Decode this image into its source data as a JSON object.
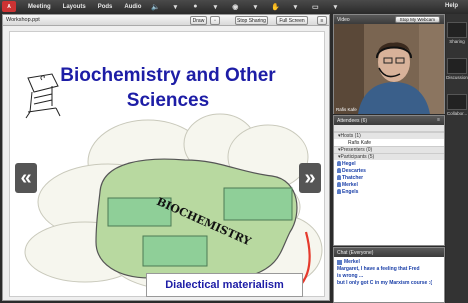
{
  "menubar": {
    "logo": "Adobe",
    "items": [
      "Meeting",
      "Layouts",
      "Pods",
      "Audio"
    ],
    "help": "Help"
  },
  "workpod": {
    "title": "Workshop.ppt",
    "buttons": [
      "Draw",
      "Stop Sharing",
      "Full Screen"
    ],
    "slide": {
      "title_line1": "Biochemistry and Other",
      "title_line2": "Sciences",
      "center_label": "BIOCHEMISTRY",
      "bottom_label": "Dialectical materialism",
      "prev": "«",
      "next": "»"
    }
  },
  "video": {
    "title": "Video",
    "button": "Stop My Webcam",
    "name_tag": "Rafis Kafe"
  },
  "attendees": {
    "title": "Attendees (6)",
    "hosts_header": "Hosts (1)",
    "host": "Rafis Kafe",
    "presenters_header": "Presenters (0)",
    "participants_header": "Participants (5)",
    "participants": [
      "Hegel",
      "Descartes",
      "Thatcher",
      "Merkel",
      "Engels"
    ]
  },
  "chat": {
    "title": "Chat (Everyone)",
    "sender": "Merkel",
    "messages": [
      "Margaret, I have a feeling that Fred",
      "is wrong ...",
      "but I only got C in my Marxism course :("
    ]
  },
  "sidebar": {
    "labels": [
      "Sharing",
      "Discussion",
      "Collabor..."
    ]
  },
  "colors": {
    "accent": "#1d1da6",
    "blob_green": "#b8d9a0",
    "box_green": "#8fcf98",
    "red_arrow": "#e53a2c"
  }
}
